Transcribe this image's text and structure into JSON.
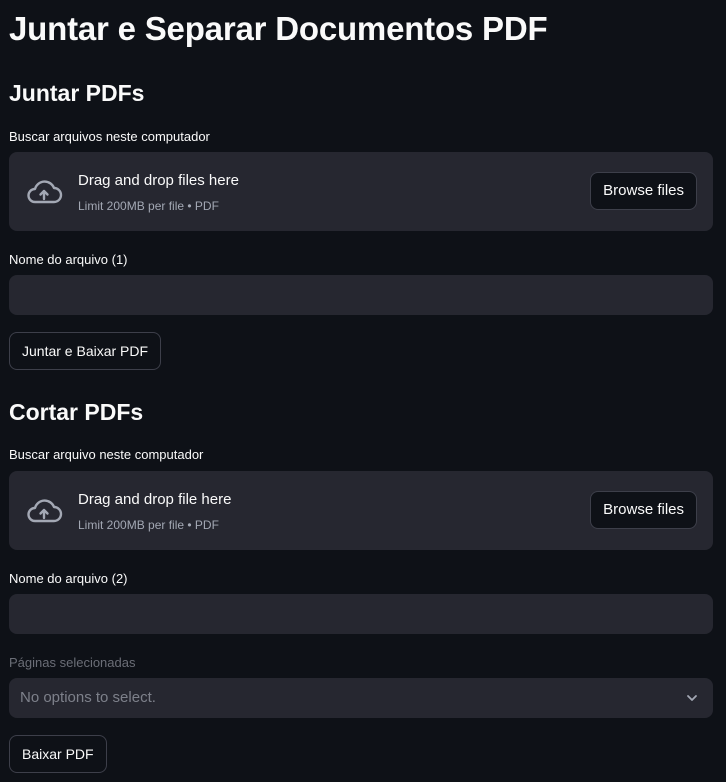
{
  "page": {
    "title": "Juntar e Separar Documentos PDF"
  },
  "merge": {
    "heading": "Juntar PDFs",
    "uploader_label": "Buscar arquivos neste computador",
    "dropzone_title": "Drag and drop files here",
    "dropzone_limit": "Limit 200MB per file • PDF",
    "browse_label": "Browse files",
    "filename_label": "Nome do arquivo (1)",
    "filename_value": "",
    "action_label": "Juntar e Baixar PDF"
  },
  "split": {
    "heading": "Cortar PDFs",
    "uploader_label": "Buscar arquivo neste computador",
    "dropzone_title": "Drag and drop file here",
    "dropzone_limit": "Limit 200MB per file • PDF",
    "browse_label": "Browse files",
    "filename_label": "Nome do arquivo (2)",
    "filename_value": "",
    "pages_label": "Páginas selecionadas",
    "pages_placeholder": "No options to select.",
    "action_label": "Baixar PDF"
  },
  "icons": {
    "upload": "cloud-upload-icon",
    "dropdown": "chevron-down-icon"
  },
  "colors": {
    "background": "#0e1117",
    "surface": "#262730",
    "text": "#fafafa",
    "muted": "#a3a8b4",
    "border": "#3d3f4a"
  }
}
